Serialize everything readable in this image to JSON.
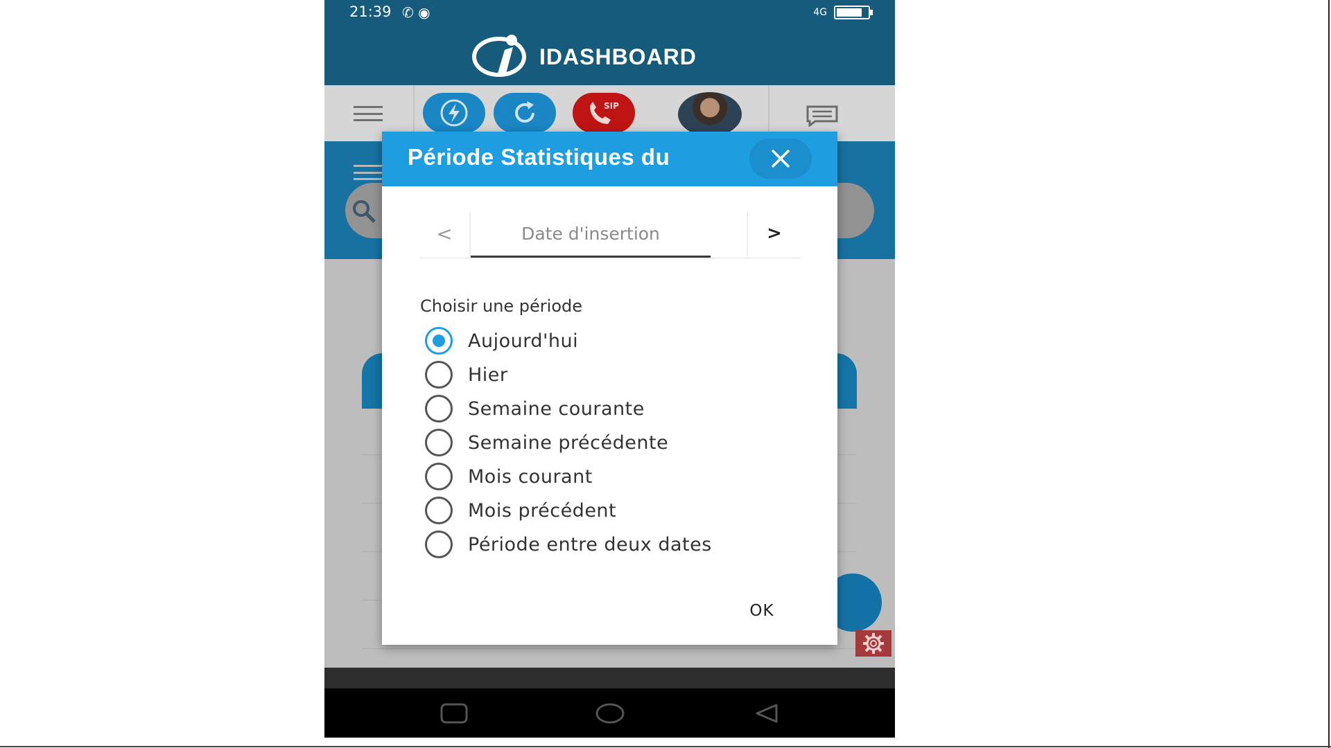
{
  "status_bar": {
    "time": "21:39",
    "network": "4G"
  },
  "app": {
    "brand_name": "IDASHBOARD"
  },
  "toolbar": {
    "buttons": [
      {
        "icon": "flash-icon",
        "color": "#1a86c4"
      },
      {
        "icon": "refresh-icon",
        "color": "#1a86c4"
      },
      {
        "icon": "sip-phone-icon",
        "label": "SIP",
        "color": "#c01414"
      }
    ],
    "avatar_icon": "user-avatar",
    "chat_icon": "chat-icon"
  },
  "dialog": {
    "title": "Période Statistiques du",
    "tabs": {
      "prev": "<",
      "active": "Date d'insertion",
      "next": ">"
    },
    "period_label": "Choisir une période",
    "options": [
      {
        "label": "Aujourd'hui",
        "checked": true
      },
      {
        "label": "Hier",
        "checked": false
      },
      {
        "label": "Semaine courante",
        "checked": false
      },
      {
        "label": "Semaine précédente",
        "checked": false
      },
      {
        "label": "Mois courant",
        "checked": false
      },
      {
        "label": "Mois précédent",
        "checked": false
      },
      {
        "label": "Période entre deux dates",
        "checked": false
      }
    ],
    "ok_label": "OK"
  },
  "colors": {
    "header": "#165a7c",
    "accent": "#1e9ee1",
    "sip": "#c01414"
  }
}
